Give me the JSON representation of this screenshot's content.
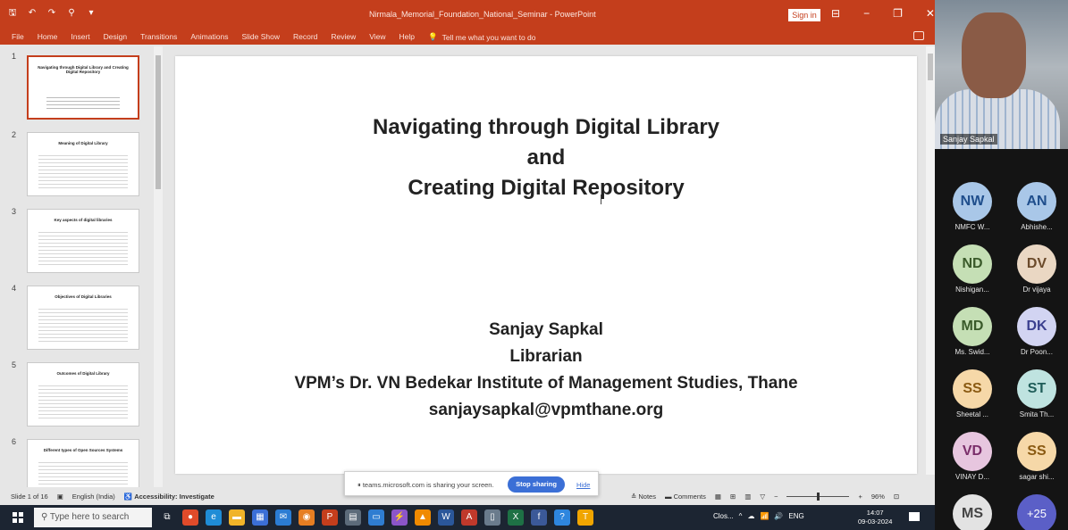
{
  "window": {
    "title": "Nirmala_Memorial_Foundation_National_Seminar - PowerPoint",
    "sign_in": "Sign in",
    "controls": [
      "⊟",
      "−",
      "❐",
      "✕"
    ]
  },
  "quick_access": [
    "🖫",
    "↶",
    "↷",
    "⚲",
    "▾"
  ],
  "ribbon": {
    "tabs": [
      "File",
      "Home",
      "Insert",
      "Design",
      "Transitions",
      "Animations",
      "Slide Show",
      "Record",
      "Review",
      "View",
      "Help"
    ],
    "tell_me": "Tell me what you want to do"
  },
  "thumbnails": [
    {
      "num": "1",
      "title": "Navigating through Digital Library and Creating Digital Repository"
    },
    {
      "num": "2",
      "title": "Meaning of Digital Library"
    },
    {
      "num": "3",
      "title": "Key aspects of digital libraries"
    },
    {
      "num": "4",
      "title": "Objectives of Digital Libraries"
    },
    {
      "num": "5",
      "title": "Outcomes of Digital Library"
    },
    {
      "num": "6",
      "title": "Different types of Open Sources Systems"
    }
  ],
  "slide": {
    "title_lines": [
      "Navigating through Digital Library",
      "and",
      "Creating Digital Repository"
    ],
    "presenter": "Sanjay Sapkal",
    "role": "Librarian",
    "institute": "VPM’s Dr. VN Bedekar Institute of Management Studies, Thane",
    "email": "sanjaysapkal@vpmthane.org"
  },
  "status": {
    "slide_info": "Slide 1 of 16",
    "language": "English (India)",
    "accessibility": "Accessibility: Investigate",
    "notes": "Notes",
    "comments": "Comments",
    "zoom": "96%"
  },
  "share_bar": {
    "text": "teams.microsoft.com is sharing your screen.",
    "stop": "Stop sharing",
    "hide": "Hide"
  },
  "teams": {
    "speaker_name": "Sanjay Sapkal",
    "participants": [
      {
        "initials": "NW",
        "name": "NMFC W...",
        "bg": "#a9c7e8",
        "fg": "#1f4e8c"
      },
      {
        "initials": "AN",
        "name": "Abhishe...",
        "bg": "#a9c7e8",
        "fg": "#1f4e8c"
      },
      {
        "initials": "ND",
        "name": "Nishigan...",
        "bg": "#c5dfb5",
        "fg": "#3a5a2a"
      },
      {
        "initials": "DV",
        "name": "Dr vijaya",
        "bg": "#ead7c3",
        "fg": "#6b4a2b"
      },
      {
        "initials": "MD",
        "name": "Ms. Swid...",
        "bg": "#c5dfb5",
        "fg": "#3a5a2a"
      },
      {
        "initials": "DK",
        "name": "Dr Poon...",
        "bg": "#d2d4f2",
        "fg": "#3b3f8f"
      },
      {
        "initials": "SS",
        "name": "Sheetal ...",
        "bg": "#f6d8a8",
        "fg": "#8a5a12"
      },
      {
        "initials": "ST",
        "name": "Smita Th...",
        "bg": "#bfe3e0",
        "fg": "#1f5d59"
      },
      {
        "initials": "VD",
        "name": "VINAY D...",
        "bg": "#e7c6df",
        "fg": "#7a2e6a"
      },
      {
        "initials": "SS",
        "name": "sagar shi...",
        "bg": "#f6d8a8",
        "fg": "#8a5a12"
      },
      {
        "initials": "MS",
        "name": "",
        "bg": "#e3e3e3",
        "fg": "#444"
      }
    ],
    "more": "+25"
  },
  "taskbar": {
    "search_placeholder": "Type here to search",
    "app_label": "Clos...",
    "language": "ENG",
    "time": "14:07",
    "date": "09-03-2024",
    "icons": [
      {
        "name": "task-view-icon",
        "glyph": "⧉",
        "bg": "transparent"
      },
      {
        "name": "chrome-icon",
        "glyph": "●",
        "bg": "#e04b2a"
      },
      {
        "name": "edge-icon",
        "glyph": "e",
        "bg": "#1f8cd6"
      },
      {
        "name": "file-explorer-icon",
        "glyph": "▬",
        "bg": "#f0b429"
      },
      {
        "name": "store-icon",
        "glyph": "▦",
        "bg": "#3b6fd6"
      },
      {
        "name": "mail-icon",
        "glyph": "✉",
        "bg": "#2b7cd3"
      },
      {
        "name": "photos-icon",
        "glyph": "◉",
        "bg": "#e67e22"
      },
      {
        "name": "powerpoint-icon",
        "glyph": "P",
        "bg": "#c43e1c"
      },
      {
        "name": "calculator-icon",
        "glyph": "▤",
        "bg": "#5c6b7a"
      },
      {
        "name": "folder-icon",
        "glyph": "▭",
        "bg": "#2f7dd1"
      },
      {
        "name": "app-icon",
        "glyph": "⚡",
        "bg": "#8b55c9"
      },
      {
        "name": "vlc-icon",
        "glyph": "▲",
        "bg": "#f08a00"
      },
      {
        "name": "word-icon",
        "glyph": "W",
        "bg": "#2b579a"
      },
      {
        "name": "pdf-icon",
        "glyph": "A",
        "bg": "#c0392b"
      },
      {
        "name": "notes-icon",
        "glyph": "▯",
        "bg": "#6a7b8c"
      },
      {
        "name": "excel-icon",
        "glyph": "X",
        "bg": "#1e7145"
      },
      {
        "name": "facebook-icon",
        "glyph": "f",
        "bg": "#3b5998"
      },
      {
        "name": "help-icon",
        "glyph": "?",
        "bg": "#2e86de"
      },
      {
        "name": "teams-icon",
        "glyph": "T",
        "bg": "#f0a500"
      }
    ]
  }
}
